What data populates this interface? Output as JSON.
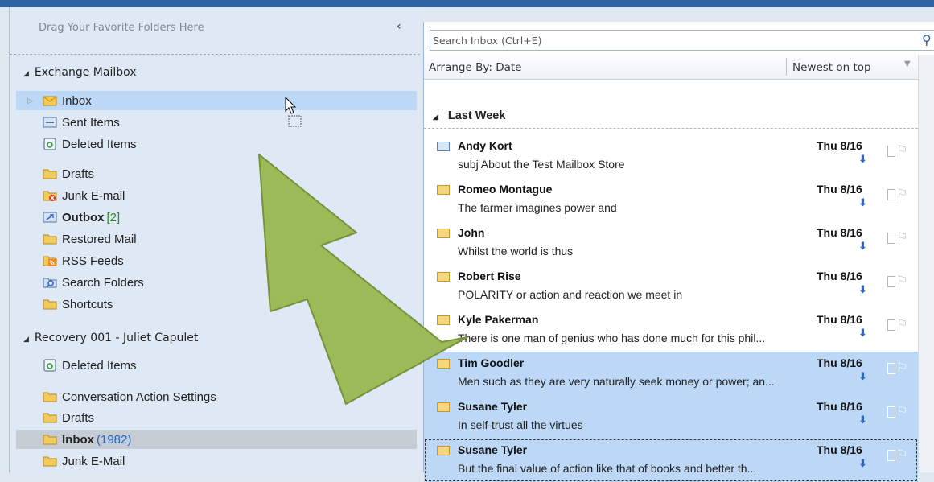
{
  "nav": {
    "favorites_hint": "Drag Your Favorite Folders Here",
    "collapse_glyph": "‹",
    "sections": [
      {
        "title": "Exchange Mailbox",
        "folders": [
          {
            "label": "Inbox",
            "icon": "inbox-icon",
            "selected": true
          },
          {
            "label": "Sent Items",
            "icon": "sent-items-icon"
          },
          {
            "label": "Deleted Items",
            "icon": "deleted-items-icon"
          },
          {
            "label": "Drafts",
            "icon": "folder-icon"
          },
          {
            "label": "Junk E-mail",
            "icon": "junk-icon"
          },
          {
            "label": "Outbox",
            "icon": "outbox-icon",
            "count": "[2]"
          },
          {
            "label": "Restored Mail",
            "icon": "folder-icon"
          },
          {
            "label": "RSS Feeds",
            "icon": "rss-icon"
          },
          {
            "label": "Search Folders",
            "icon": "search-folder-icon"
          },
          {
            "label": "Shortcuts",
            "icon": "folder-icon"
          }
        ]
      },
      {
        "title": "Recovery 001 - Juliet Capulet",
        "folders": [
          {
            "label": "Deleted Items",
            "icon": "deleted-items-icon"
          },
          {
            "label": "Conversation Action Settings",
            "icon": "folder-icon"
          },
          {
            "label": "Drafts",
            "icon": "folder-icon"
          },
          {
            "label": "Inbox",
            "icon": "folder-icon",
            "count": "(1982)"
          },
          {
            "label": "Junk E-Mail",
            "icon": "folder-icon"
          }
        ]
      }
    ]
  },
  "search": {
    "placeholder": "Search Inbox (Ctrl+E)"
  },
  "arrange": {
    "by": "Arrange By: Date",
    "order": "Newest on top"
  },
  "group": {
    "title": "Last Week"
  },
  "messages": [
    {
      "sender": "Andy Kort",
      "date": "Thu 8/16",
      "subject": "subj About the Test Mailbox Store",
      "read": true
    },
    {
      "sender": "Romeo Montague",
      "date": "Thu 8/16",
      "subject": "The farmer imagines power and"
    },
    {
      "sender": "John",
      "date": "Thu 8/16",
      "subject": "Whilst the world is thus"
    },
    {
      "sender": "Robert Rise",
      "date": "Thu 8/16",
      "subject": "POLARITY or action and reaction we meet in"
    },
    {
      "sender": "Kyle Pakerman",
      "date": "Thu 8/16",
      "subject": "There is one man of genius who has done much for this phil..."
    },
    {
      "sender": "Tim Goodler",
      "date": "Thu 8/16",
      "subject": "Men such as they are very naturally seek money or power; an...",
      "selected": true
    },
    {
      "sender": "Susane Tyler",
      "date": "Thu 8/16",
      "subject": "In self-trust all the virtues",
      "selected": true
    },
    {
      "sender": "Susane Tyler",
      "date": "Thu 8/16",
      "subject": "But the final value of action like that of books and better th...",
      "selected": true,
      "focused": true
    }
  ],
  "colors": {
    "accent": "#2e64a4",
    "selection": "#bcd8f6",
    "arrow_fill": "#9bbb59",
    "arrow_stroke": "#76923c"
  }
}
